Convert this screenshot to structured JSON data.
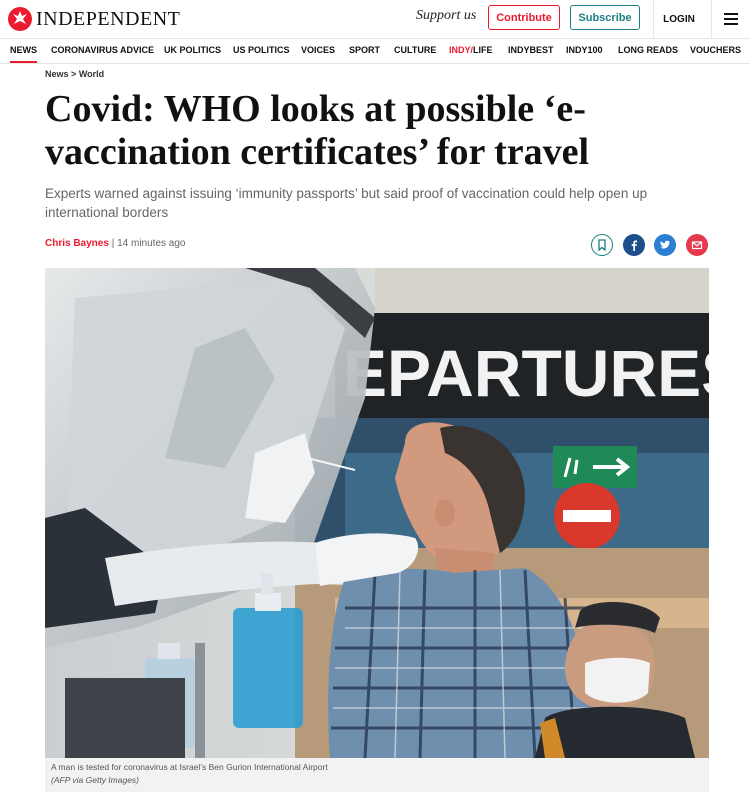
{
  "header": {
    "logo_text": "INDEPENDENT",
    "support_text": "Support us",
    "contribute_label": "Contribute",
    "subscribe_label": "Subscribe",
    "login_label": "LOGIN",
    "menu_icon": "hamburger-icon",
    "logo_icon": "eagle-icon"
  },
  "nav": {
    "items": [
      {
        "label": "NEWS"
      },
      {
        "label": "CORONAVIRUS ADVICE"
      },
      {
        "label": "UK POLITICS"
      },
      {
        "label": "US POLITICS"
      },
      {
        "label": "VOICES"
      },
      {
        "label": "SPORT"
      },
      {
        "label": "CULTURE"
      },
      {
        "label_a": "INDY/",
        "label_b": "LIFE"
      },
      {
        "label": "INDYBEST"
      },
      {
        "label": "INDY100"
      },
      {
        "label": "LONG READS"
      },
      {
        "label": "VOUCHERS"
      }
    ]
  },
  "article": {
    "breadcrumb": [
      "News",
      ">",
      "World"
    ],
    "headline": "Covid: WHO looks at possible ‘e-vaccination certificates’ for travel",
    "standfirst": "Experts warned against issuing ‘immunity passports’ but said proof of vaccination could help open up international borders",
    "author": "Chris Baynes",
    "separator": "|",
    "time": "14 minutes ago",
    "share_icons": [
      "bookmark-icon",
      "facebook-icon",
      "twitter-icon",
      "email-icon"
    ],
    "photo": {
      "sign_text": "EPARTURES",
      "caption": "A man is tested for coronavirus at Israel’s Ben Gurion International Airport",
      "credit": "(AFP via Getty Images)"
    }
  },
  "colors": {
    "brand_red": "#ec1a2e",
    "teal": "#1b7f83",
    "facebook": "#1d4f8c",
    "twitter": "#2a7fd0",
    "mail": "#e53a4c"
  }
}
